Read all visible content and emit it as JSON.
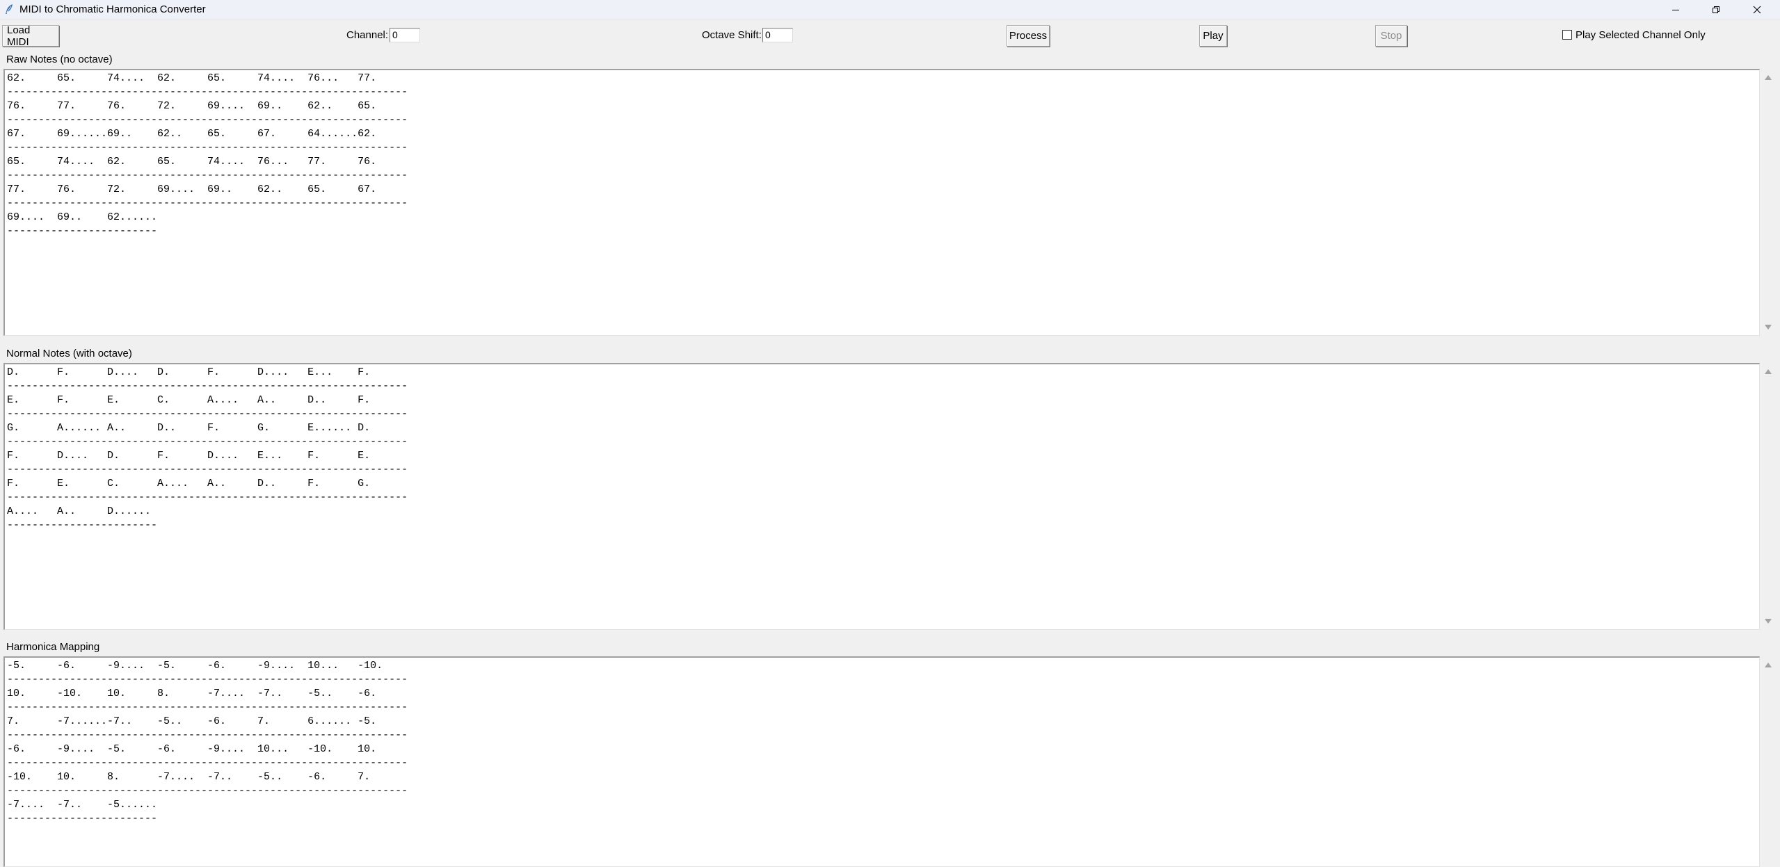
{
  "window": {
    "title": "MIDI to Chromatic Harmonica Converter",
    "minimize_icon": "minimize-icon",
    "restore_icon": "restore-icon",
    "close_icon": "close-icon"
  },
  "toolbar": {
    "load_midi_label": "Load MIDI",
    "channel_label": "Channel:",
    "channel_value": "0",
    "octave_shift_label": "Octave Shift:",
    "octave_shift_value": "0",
    "process_label": "Process",
    "play_label": "Play",
    "stop_label": "Stop",
    "stop_disabled": true,
    "play_selected_label": "Play Selected Channel Only",
    "play_selected_checked": false
  },
  "sections": {
    "raw": {
      "title": "Raw Notes (no octave)",
      "lines": [
        "62.     65.     74....  62.     65.     74....  76...   77.",
        "----------------------------------------------------------------",
        "76.     77.     76.     72.     69....  69..    62..    65.",
        "----------------------------------------------------------------",
        "67.     69......69..    62..    65.     67.     64......62.",
        "----------------------------------------------------------------",
        "65.     74....  62.     65.     74....  76...   77.     76.",
        "----------------------------------------------------------------",
        "77.     76.     72.     69....  69..    62..    65.     67.",
        "----------------------------------------------------------------",
        "69....  69..    62......",
        "------------------------"
      ]
    },
    "normal": {
      "title": "Normal Notes (with octave)",
      "lines": [
        "D.      F.      D....   D.      F.      D....   E...    F.",
        "----------------------------------------------------------------",
        "E.      F.      E.      C.      A....   A..     D..     F.",
        "----------------------------------------------------------------",
        "G.      A...... A..     D..     F.      G.      E...... D.",
        "----------------------------------------------------------------",
        "F.      D....   D.      F.      D....   E...    F.      E.",
        "----------------------------------------------------------------",
        "F.      E.      C.      A....   A..     D..     F.      G.",
        "----------------------------------------------------------------",
        "A....   A..     D......",
        "------------------------"
      ]
    },
    "harmonica": {
      "title": "Harmonica Mapping",
      "lines": [
        "-5.     -6.     -9....  -5.     -6.     -9....  10...   -10.",
        "----------------------------------------------------------------",
        "10.     -10.    10.     8.      -7....  -7..    -5..    -6.",
        "----------------------------------------------------------------",
        "7.      -7......-7..    -5..    -6.     7.      6...... -5.",
        "----------------------------------------------------------------",
        "-6.     -9....  -5.     -6.     -9....  10...   -10.    10.",
        "----------------------------------------------------------------",
        "-10.    10.     8.      -7....  -7..    -5..    -6.     7.",
        "----------------------------------------------------------------",
        "-7....  -7..    -5......",
        "------------------------"
      ]
    }
  }
}
